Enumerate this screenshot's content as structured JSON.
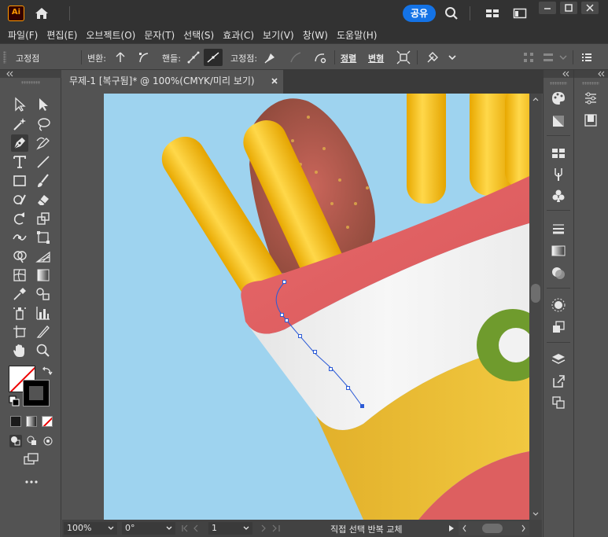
{
  "app": {
    "logo_text": "Ai",
    "share_label": "공유"
  },
  "menu": [
    "파일(F)",
    "편집(E)",
    "오브젝트(O)",
    "문자(T)",
    "선택(S)",
    "효과(C)",
    "보기(V)",
    "창(W)",
    "도움말(H)"
  ],
  "control_bar": {
    "anchor_point_label": "고정점",
    "convert_label": "변환:",
    "handles_label": "핸들:",
    "anchors_label": "고정점:",
    "align_label": "정렬",
    "transform_label": "변형"
  },
  "document": {
    "tab_title": "무제-1 [복구됨]* @ 100%(CMYK/미리 보기)"
  },
  "status": {
    "zoom": "100%",
    "rotation": "0°",
    "artboard_number": "1",
    "current_tool": "직접 선택 반복 교체"
  },
  "colors": {
    "accent": "#1473e6",
    "ui_dark": "#323232",
    "ui_mid": "#535353",
    "artboard_bg": "#9ed3ef",
    "fries_yellow": "#f5c531",
    "box_red": "#e06567",
    "box_white": "#f2f2f2",
    "box_yellow": "#f0c63a",
    "ring_green": "#6f9b2d",
    "selection_blue": "#2c5bd6"
  },
  "icons": {
    "home": "home-icon",
    "search": "search-icon",
    "workspace": "workspace-switcher-icon",
    "arrange": "arrange-documents-icon"
  }
}
